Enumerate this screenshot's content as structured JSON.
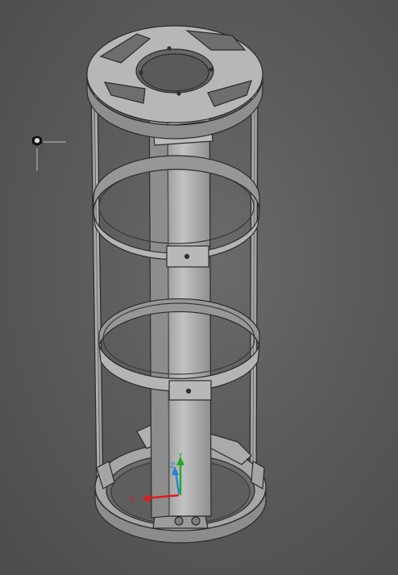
{
  "viewport": {
    "background_color": "#5a5a5a",
    "part_color": "#9a9a9a",
    "edge_color": "#2a2a2a"
  },
  "view_cube": {
    "icon": "hexagon-navigation-icon",
    "color": "#111111"
  },
  "triad": {
    "x_label": "X",
    "y_label": "Y",
    "z_label": "Z",
    "x_color": "#e01b1b",
    "y_color": "#1faa2d",
    "z_color": "#2a7fd6"
  }
}
